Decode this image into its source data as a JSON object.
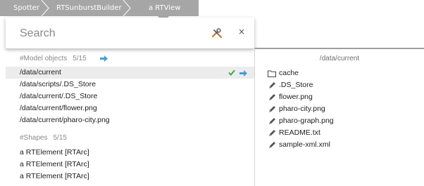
{
  "breadcrumb": [
    {
      "label": "Spotter"
    },
    {
      "label": "RTSunburstBuilder"
    },
    {
      "label": "a RTView"
    }
  ],
  "search": {
    "placeholder": "Search",
    "value": ""
  },
  "icons": {
    "tools": "wrench-screwdriver-icon",
    "close": "close-icon"
  },
  "close_glyph": "×",
  "categories": [
    {
      "title": "#Model objects",
      "count": "5/15",
      "items": [
        {
          "label": "/data/current",
          "selected": true
        },
        {
          "label": "/data/scripts/.DS_Store"
        },
        {
          "label": "/data/current/.DS_Store"
        },
        {
          "label": "/data/current/flower.png"
        },
        {
          "label": "/data/current/pharo-city.png"
        }
      ]
    },
    {
      "title": "#Shapes",
      "count": "5/15",
      "items": [
        {
          "label": "a RTElement [RTArc]"
        },
        {
          "label": "a RTElement [RTArc]"
        },
        {
          "label": "a RTElement [RTArc]"
        }
      ]
    }
  ],
  "preview": {
    "title": "/data/current",
    "items": [
      {
        "name": "cache",
        "icon": "folder-icon"
      },
      {
        "name": ".DS_Store",
        "icon": "pencil-icon"
      },
      {
        "name": "flower.png",
        "icon": "pencil-icon"
      },
      {
        "name": "pharo-city.png",
        "icon": "pencil-icon"
      },
      {
        "name": "pharo-graph.png",
        "icon": "pencil-icon"
      },
      {
        "name": "README.txt",
        "icon": "pencil-icon"
      },
      {
        "name": "sample-xml.xml",
        "icon": "pencil-icon"
      }
    ]
  },
  "colors": {
    "accent_blue": "#3ea0d8",
    "check_green": "#3aa845",
    "breadcrumb_bg": "#a6a6a6",
    "selected_row_bg": "#ececec"
  }
}
